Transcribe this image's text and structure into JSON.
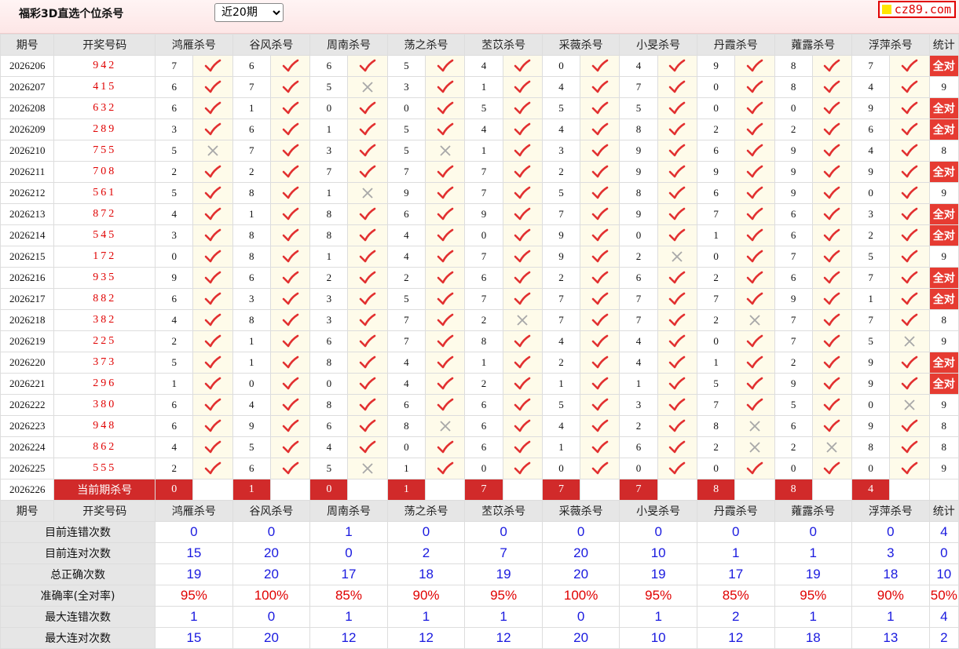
{
  "header": {
    "title": "福彩3D直选个位杀号",
    "range_select": {
      "selected": "近20期"
    },
    "logo_text": "cz89.com"
  },
  "colors": {
    "accent_red": "#e63b32",
    "value_blue": "#1a1adf",
    "draw_red": "#e00000"
  },
  "columns": {
    "period": "期号",
    "draw": "开奖号码",
    "experts": [
      "鸿雁杀号",
      "谷风杀号",
      "周南杀号",
      "荡之杀号",
      "苤苡杀号",
      "采薇杀号",
      "小旻杀号",
      "丹霞杀号",
      "蕹露杀号",
      "浮萍杀号"
    ],
    "stat": "统计"
  },
  "rows": [
    {
      "period": "2026206",
      "draw": "942",
      "kills": [
        "7",
        "6",
        "6",
        "5",
        "4",
        "0",
        "4",
        "9",
        "8",
        "7"
      ],
      "hits": [
        1,
        1,
        1,
        1,
        1,
        1,
        1,
        1,
        1,
        1
      ],
      "stat": "全对"
    },
    {
      "period": "2026207",
      "draw": "415",
      "kills": [
        "6",
        "7",
        "5",
        "3",
        "1",
        "4",
        "7",
        "0",
        "8",
        "4"
      ],
      "hits": [
        1,
        1,
        0,
        1,
        1,
        1,
        1,
        1,
        1,
        1
      ],
      "stat": "9"
    },
    {
      "period": "2026208",
      "draw": "632",
      "kills": [
        "6",
        "1",
        "0",
        "0",
        "5",
        "5",
        "5",
        "0",
        "0",
        "9"
      ],
      "hits": [
        1,
        1,
        1,
        1,
        1,
        1,
        1,
        1,
        1,
        1
      ],
      "stat": "全对"
    },
    {
      "period": "2026209",
      "draw": "289",
      "kills": [
        "3",
        "6",
        "1",
        "5",
        "4",
        "4",
        "8",
        "2",
        "2",
        "6"
      ],
      "hits": [
        1,
        1,
        1,
        1,
        1,
        1,
        1,
        1,
        1,
        1
      ],
      "stat": "全对"
    },
    {
      "period": "2026210",
      "draw": "755",
      "kills": [
        "5",
        "7",
        "3",
        "5",
        "1",
        "3",
        "9",
        "6",
        "9",
        "4"
      ],
      "hits": [
        0,
        1,
        1,
        0,
        1,
        1,
        1,
        1,
        1,
        1
      ],
      "stat": "8"
    },
    {
      "period": "2026211",
      "draw": "708",
      "kills": [
        "2",
        "2",
        "7",
        "7",
        "7",
        "2",
        "9",
        "9",
        "9",
        "9"
      ],
      "hits": [
        1,
        1,
        1,
        1,
        1,
        1,
        1,
        1,
        1,
        1
      ],
      "stat": "全对"
    },
    {
      "period": "2026212",
      "draw": "561",
      "kills": [
        "5",
        "8",
        "1",
        "9",
        "7",
        "5",
        "8",
        "6",
        "9",
        "0"
      ],
      "hits": [
        1,
        1,
        0,
        1,
        1,
        1,
        1,
        1,
        1,
        1
      ],
      "stat": "9"
    },
    {
      "period": "2026213",
      "draw": "872",
      "kills": [
        "4",
        "1",
        "8",
        "6",
        "9",
        "7",
        "9",
        "7",
        "6",
        "3"
      ],
      "hits": [
        1,
        1,
        1,
        1,
        1,
        1,
        1,
        1,
        1,
        1
      ],
      "stat": "全对"
    },
    {
      "period": "2026214",
      "draw": "545",
      "kills": [
        "3",
        "8",
        "8",
        "4",
        "0",
        "9",
        "0",
        "1",
        "6",
        "2"
      ],
      "hits": [
        1,
        1,
        1,
        1,
        1,
        1,
        1,
        1,
        1,
        1
      ],
      "stat": "全对"
    },
    {
      "period": "2026215",
      "draw": "172",
      "kills": [
        "0",
        "8",
        "1",
        "4",
        "7",
        "9",
        "2",
        "0",
        "7",
        "5"
      ],
      "hits": [
        1,
        1,
        1,
        1,
        1,
        1,
        0,
        1,
        1,
        1
      ],
      "stat": "9"
    },
    {
      "period": "2026216",
      "draw": "935",
      "kills": [
        "9",
        "6",
        "2",
        "2",
        "6",
        "2",
        "6",
        "2",
        "6",
        "7"
      ],
      "hits": [
        1,
        1,
        1,
        1,
        1,
        1,
        1,
        1,
        1,
        1
      ],
      "stat": "全对"
    },
    {
      "period": "2026217",
      "draw": "882",
      "kills": [
        "6",
        "3",
        "3",
        "5",
        "7",
        "7",
        "7",
        "7",
        "9",
        "1"
      ],
      "hits": [
        1,
        1,
        1,
        1,
        1,
        1,
        1,
        1,
        1,
        1
      ],
      "stat": "全对"
    },
    {
      "period": "2026218",
      "draw": "382",
      "kills": [
        "4",
        "8",
        "3",
        "7",
        "2",
        "7",
        "7",
        "2",
        "7",
        "7"
      ],
      "hits": [
        1,
        1,
        1,
        1,
        0,
        1,
        1,
        0,
        1,
        1
      ],
      "stat": "8"
    },
    {
      "period": "2026219",
      "draw": "225",
      "kills": [
        "2",
        "1",
        "6",
        "7",
        "8",
        "4",
        "4",
        "0",
        "7",
        "5"
      ],
      "hits": [
        1,
        1,
        1,
        1,
        1,
        1,
        1,
        1,
        1,
        0
      ],
      "stat": "9"
    },
    {
      "period": "2026220",
      "draw": "373",
      "kills": [
        "5",
        "1",
        "8",
        "4",
        "1",
        "2",
        "4",
        "1",
        "2",
        "9"
      ],
      "hits": [
        1,
        1,
        1,
        1,
        1,
        1,
        1,
        1,
        1,
        1
      ],
      "stat": "全对"
    },
    {
      "period": "2026221",
      "draw": "296",
      "kills": [
        "1",
        "0",
        "0",
        "4",
        "2",
        "1",
        "1",
        "5",
        "9",
        "9"
      ],
      "hits": [
        1,
        1,
        1,
        1,
        1,
        1,
        1,
        1,
        1,
        1
      ],
      "stat": "全对"
    },
    {
      "period": "2026222",
      "draw": "380",
      "kills": [
        "6",
        "4",
        "8",
        "6",
        "6",
        "5",
        "3",
        "7",
        "5",
        "0"
      ],
      "hits": [
        1,
        1,
        1,
        1,
        1,
        1,
        1,
        1,
        1,
        0
      ],
      "stat": "9"
    },
    {
      "period": "2026223",
      "draw": "948",
      "kills": [
        "6",
        "9",
        "6",
        "8",
        "6",
        "4",
        "2",
        "8",
        "6",
        "9"
      ],
      "hits": [
        1,
        1,
        1,
        0,
        1,
        1,
        1,
        0,
        1,
        1
      ],
      "stat": "8"
    },
    {
      "period": "2026224",
      "draw": "862",
      "kills": [
        "4",
        "5",
        "4",
        "0",
        "6",
        "1",
        "6",
        "2",
        "2",
        "8"
      ],
      "hits": [
        1,
        1,
        1,
        1,
        1,
        1,
        1,
        0,
        0,
        1
      ],
      "stat": "8"
    },
    {
      "period": "2026225",
      "draw": "555",
      "kills": [
        "2",
        "6",
        "5",
        "1",
        "0",
        "0",
        "0",
        "0",
        "0",
        "0"
      ],
      "hits": [
        1,
        1,
        0,
        1,
        1,
        1,
        1,
        1,
        1,
        1
      ],
      "stat": "9"
    }
  ],
  "current": {
    "period": "2026226",
    "label": "当前期杀号",
    "kills": [
      "0",
      "1",
      "0",
      "1",
      "7",
      "7",
      "7",
      "8",
      "8",
      "4"
    ]
  },
  "summary": [
    {
      "label": "目前连错次数",
      "values": [
        "0",
        "0",
        "1",
        "0",
        "0",
        "0",
        "0",
        "0",
        "0",
        "0",
        "4"
      ]
    },
    {
      "label": "目前连对次数",
      "values": [
        "15",
        "20",
        "0",
        "2",
        "7",
        "20",
        "10",
        "1",
        "1",
        "3",
        "0"
      ]
    },
    {
      "label": "总正确次数",
      "values": [
        "19",
        "20",
        "17",
        "18",
        "19",
        "20",
        "19",
        "17",
        "19",
        "18",
        "10"
      ]
    },
    {
      "label": "准确率(全对率)",
      "values": [
        "95%",
        "100%",
        "85%",
        "90%",
        "95%",
        "100%",
        "95%",
        "85%",
        "95%",
        "90%",
        "50%"
      ],
      "highlight": true
    },
    {
      "label": "最大连错次数",
      "values": [
        "1",
        "0",
        "1",
        "1",
        "1",
        "0",
        "1",
        "2",
        "1",
        "1",
        "4"
      ]
    },
    {
      "label": "最大连对次数",
      "values": [
        "15",
        "20",
        "12",
        "12",
        "12",
        "20",
        "10",
        "12",
        "18",
        "13",
        "2"
      ]
    }
  ]
}
